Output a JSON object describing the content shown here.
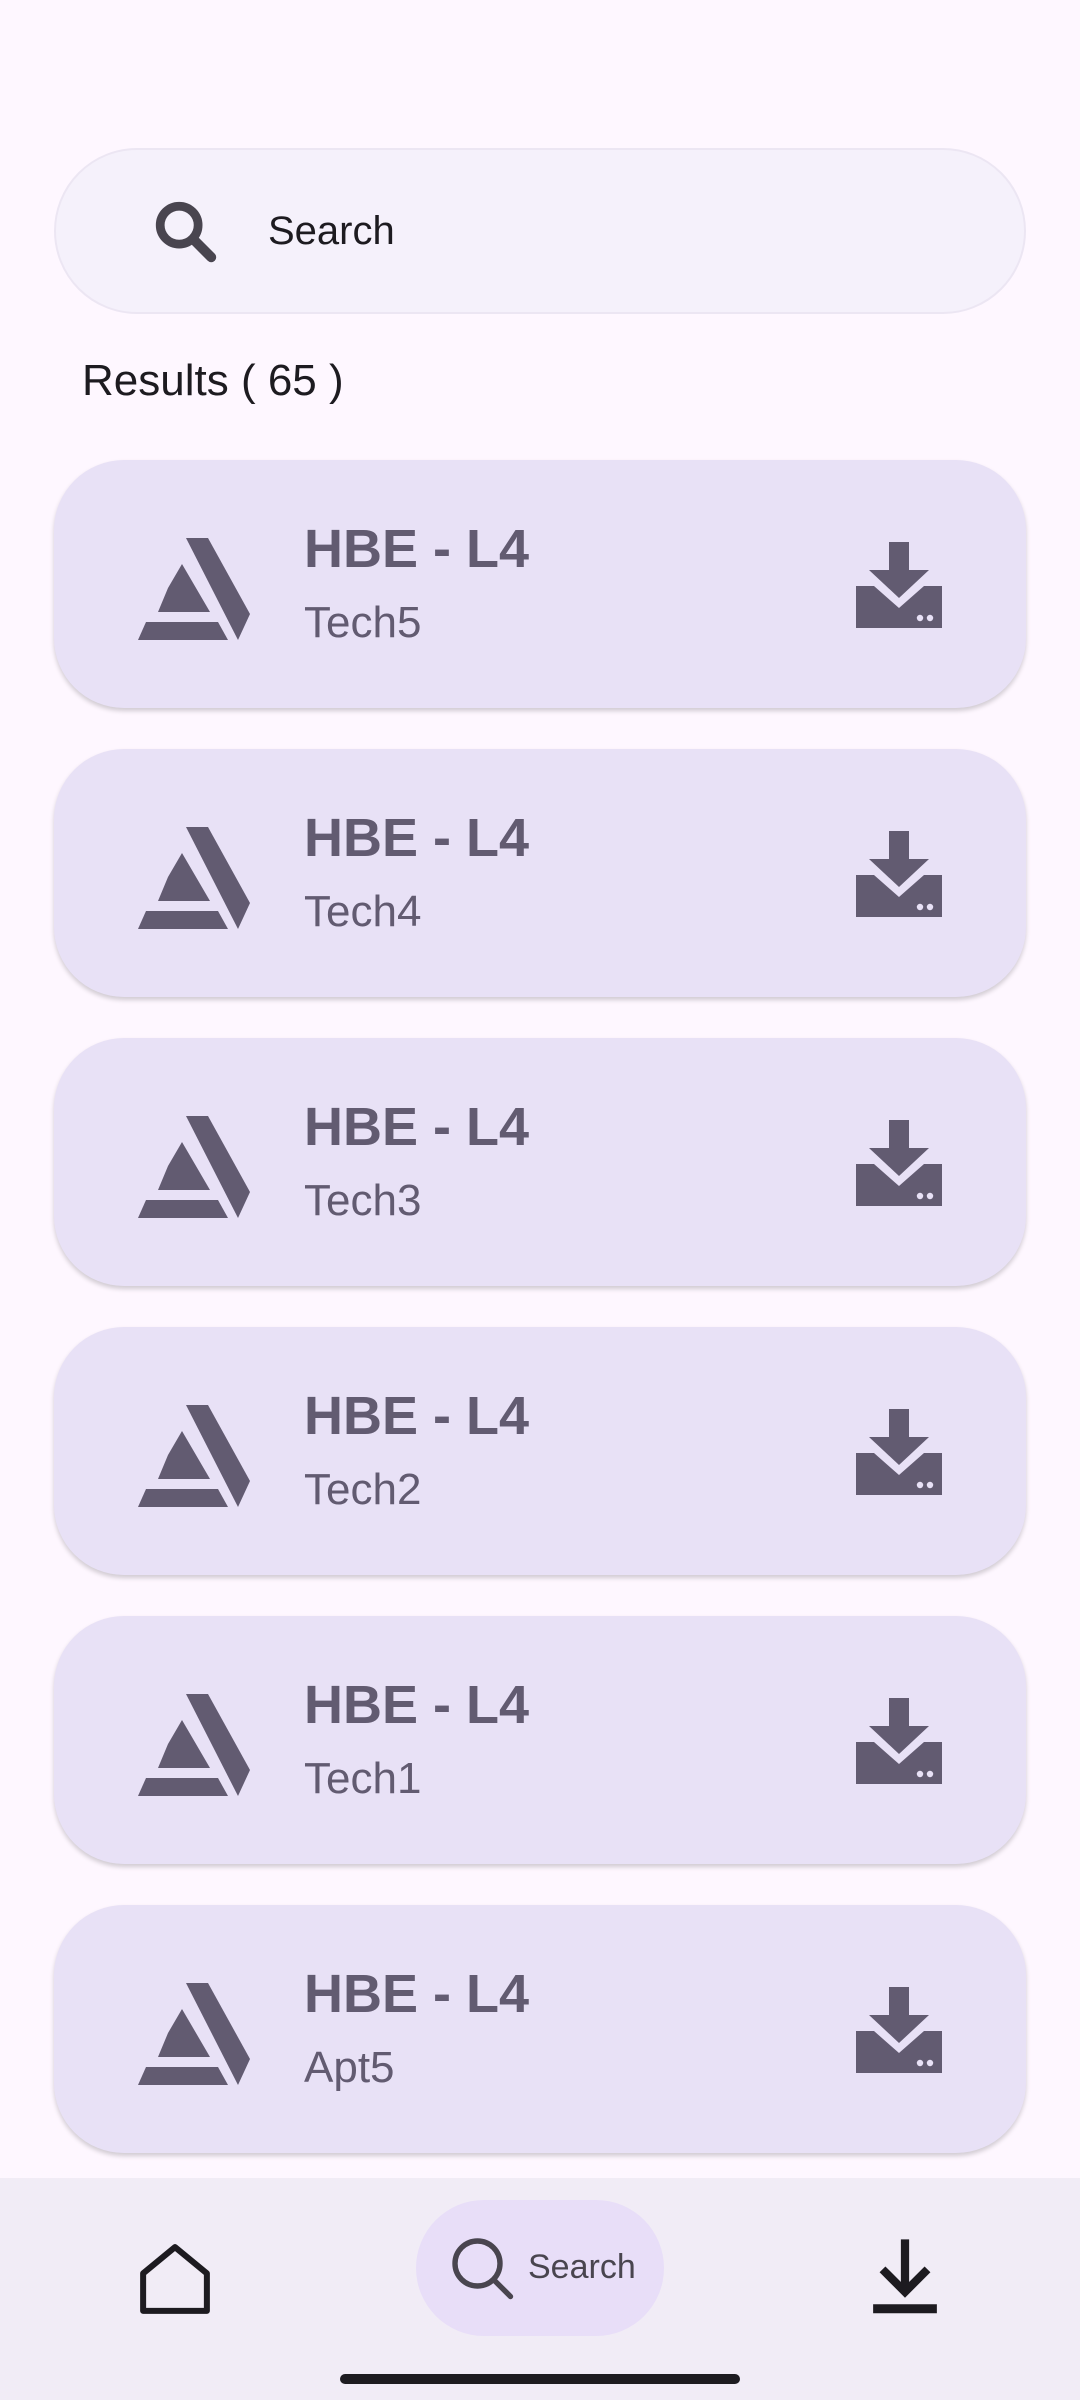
{
  "search": {
    "placeholder": "Search"
  },
  "results": {
    "label": "Results ( 65 )"
  },
  "items": [
    {
      "title": "HBE - L4",
      "subtitle": "Tech5"
    },
    {
      "title": "HBE - L4",
      "subtitle": "Tech4"
    },
    {
      "title": "HBE - L4",
      "subtitle": "Tech3"
    },
    {
      "title": "HBE - L4",
      "subtitle": "Tech2"
    },
    {
      "title": "HBE - L4",
      "subtitle": "Tech1"
    },
    {
      "title": "HBE - L4",
      "subtitle": "Apt5"
    }
  ],
  "item_icon": "artstation-logo-icon",
  "item_action_icon": "download-icon",
  "nav": {
    "home_icon": "home-icon",
    "search_label": "Search",
    "search_icon": "search-icon",
    "downloads_icon": "download-icon"
  },
  "colors": {
    "background": "#fef7ff",
    "card": "#e8e1f6",
    "card_text": "#625b71",
    "nav_background": "#f1ecf6",
    "nav_active_pill": "#e8def8"
  }
}
